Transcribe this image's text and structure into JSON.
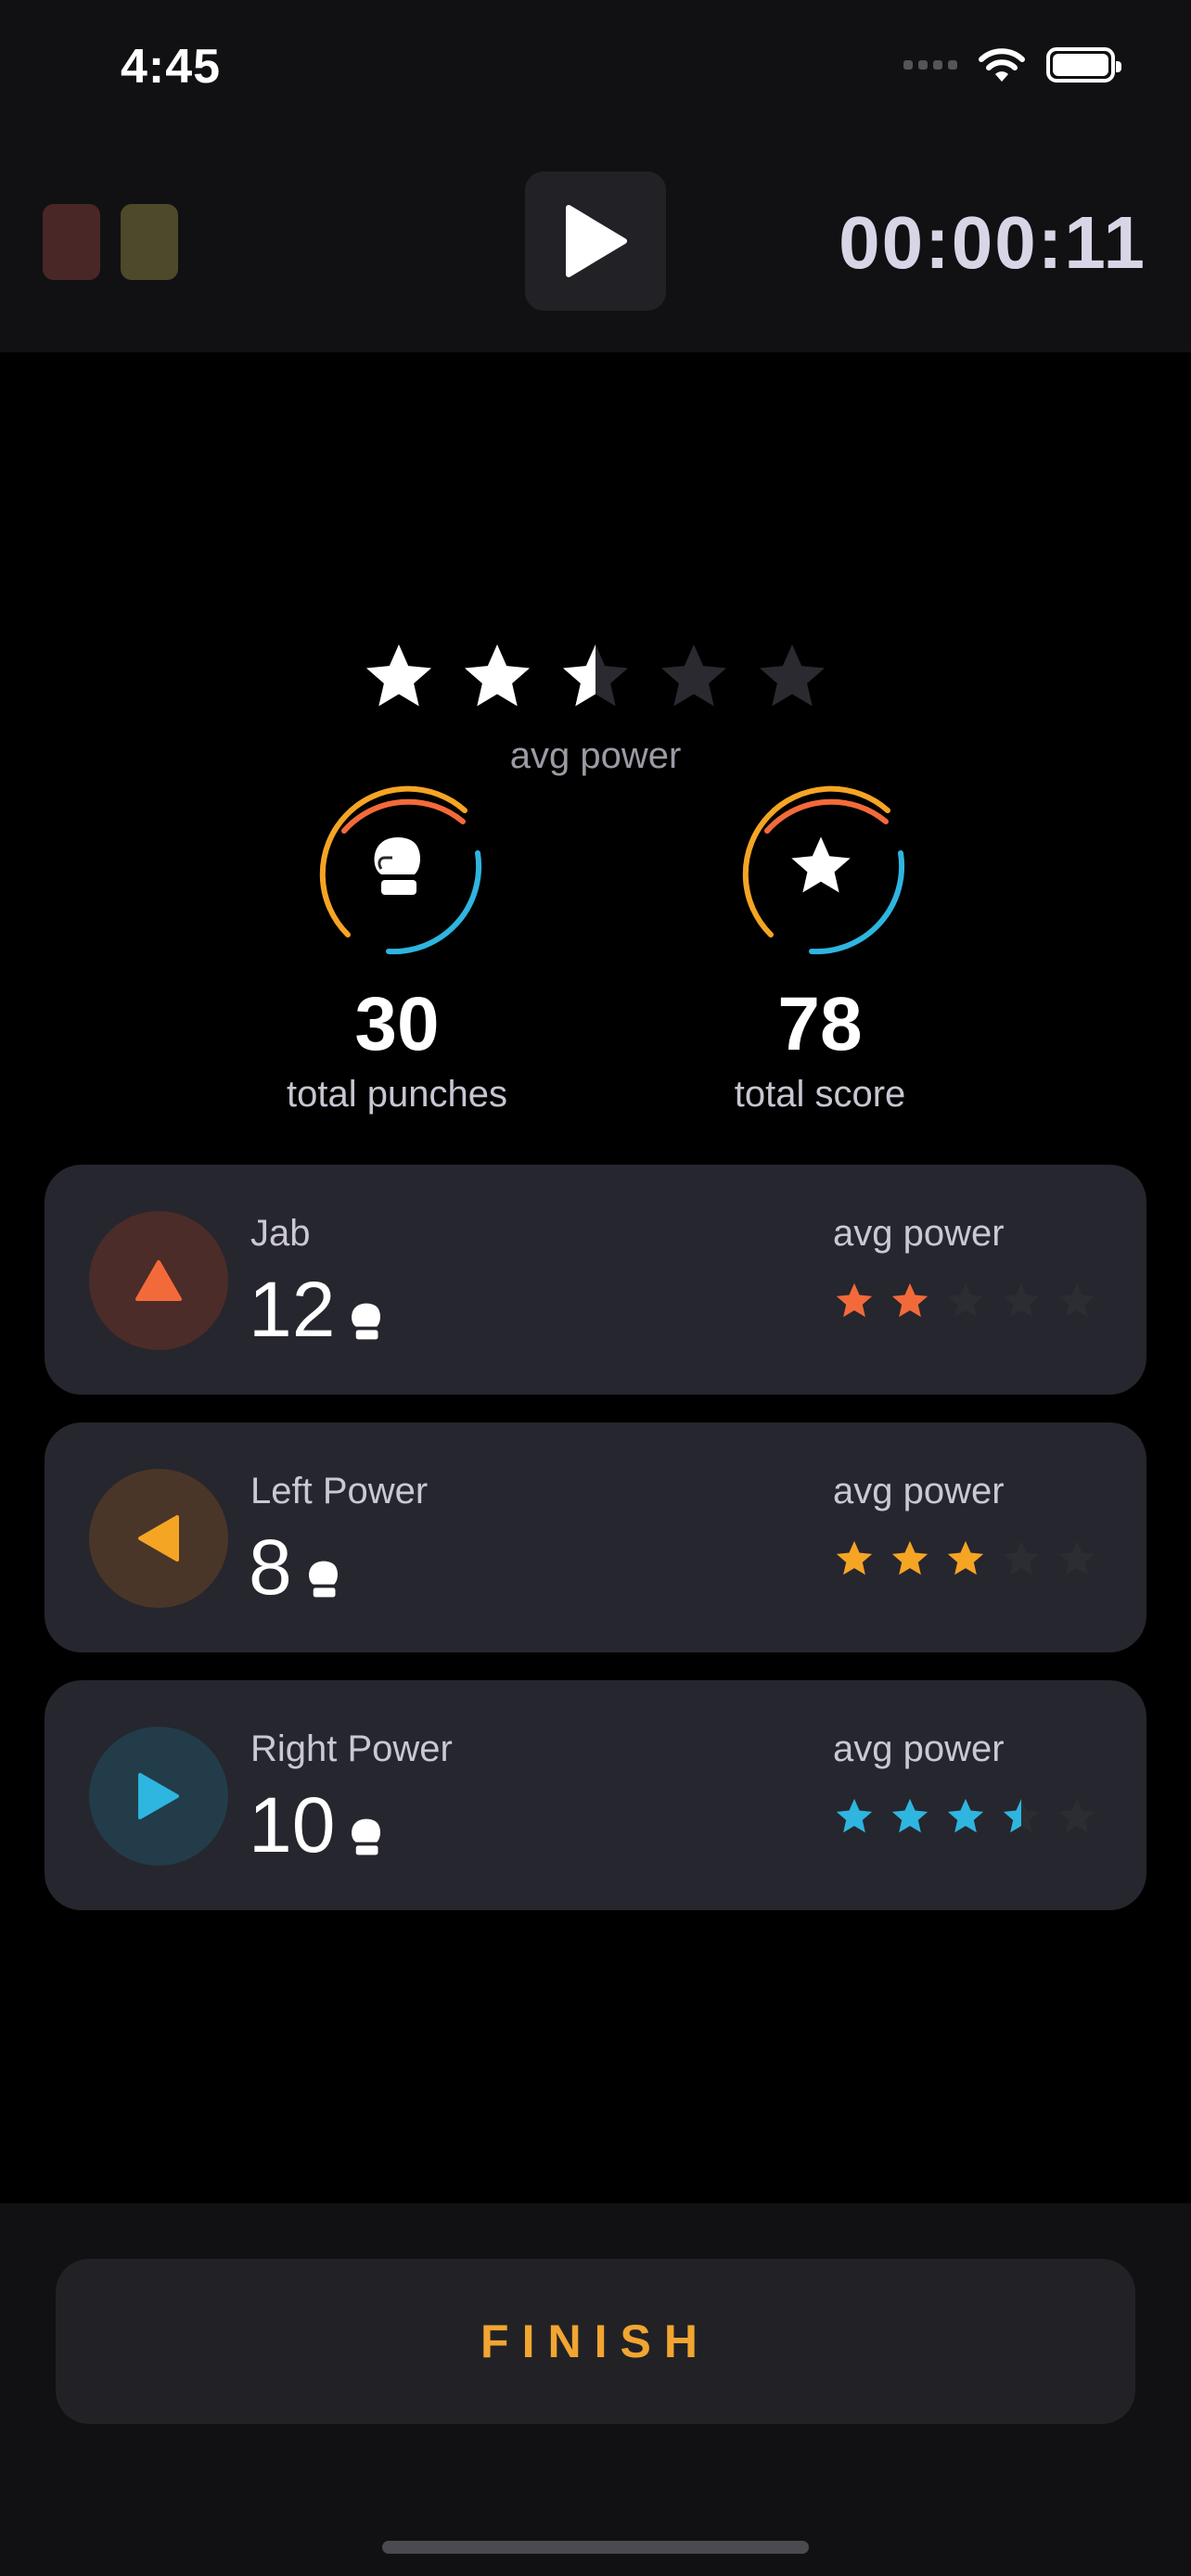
{
  "status_bar": {
    "time": "4:45"
  },
  "top_bar": {
    "timer": "00:00:11"
  },
  "summary": {
    "avg_power_stars": 2.5,
    "avg_power_label": "avg power",
    "total_punches": "30",
    "total_punches_label": "total punches",
    "total_score": "78",
    "total_score_label": "total score"
  },
  "punches": [
    {
      "name": "Jab",
      "count": "12",
      "avg_label": "avg power",
      "stars": 2,
      "color": "#f36a3a",
      "bg": "#4c2c28",
      "icon": "up-arrow-icon"
    },
    {
      "name": "Left Power",
      "count": "8",
      "avg_label": "avg power",
      "stars": 3,
      "color": "#f5a524",
      "bg": "#4a3628",
      "icon": "left-arrow-icon"
    },
    {
      "name": "Right Power",
      "count": "10",
      "avg_label": "avg power",
      "stars": 3.5,
      "color": "#2eb5e0",
      "bg": "#233c4a",
      "icon": "right-arrow-icon"
    }
  ],
  "finish_label": "FINISH",
  "colors": {
    "orange": "#f36a3a",
    "amber": "#f5a524",
    "cyan": "#2eb5e0",
    "dim_star": "#2c2c33"
  }
}
